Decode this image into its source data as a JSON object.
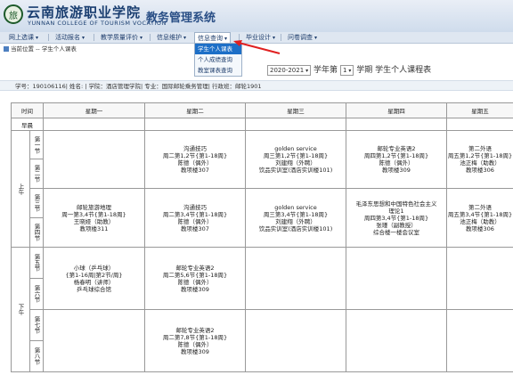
{
  "header": {
    "logo_glyph": "旅",
    "school_cn": "云南旅游职业学院",
    "school_en": "YUNNAN COLLEGE OF TOURISM VOCATION",
    "system_title": "教务管理系统"
  },
  "nav": {
    "items": [
      {
        "label": "网上选课"
      },
      {
        "label": "活动报名"
      },
      {
        "label": "教学质量评价"
      },
      {
        "label": "信息维护"
      },
      {
        "label": "信息查询"
      },
      {
        "label": "毕业设计"
      },
      {
        "label": "问卷调查"
      }
    ],
    "dropdown": [
      "学生个人课表",
      "个人成绩查询",
      "教室课表查询"
    ]
  },
  "breadcrumb": {
    "prefix": "当前位置",
    "sep": " -- ",
    "page": "学生个人课表"
  },
  "term": {
    "year": "2020-2021",
    "year_suffix": "学年第",
    "semester": "1",
    "title_suffix": "学期 学生个人课程表"
  },
  "student_info": "学号：190106116| 姓名: | 学院：酒店管理学院| 专业：国际邮轮乘务管理| 行政班：邮轮1901",
  "table": {
    "time_header": "时间",
    "days": [
      "星期一",
      "星期二",
      "星期三",
      "星期四",
      "星期五"
    ],
    "morning_early": "早晨",
    "am": "上午",
    "pm": "下午",
    "periods": [
      "第一节",
      "第二节",
      "第三节",
      "第四节",
      "第五节",
      "第六节",
      "第七节",
      "第八节"
    ],
    "courses": {
      "tue_1_2": [
        "沟通技巧",
        "周二第1,2节{第1-18周}",
        "陈德（偶外）",
        "教项楼307"
      ],
      "wed_1_2": [
        "golden service",
        "周三第1,2节{第1-18周}",
        "刘建翔（外聘）",
        "饮品实训室(酒店实训楼101)"
      ],
      "thu_1_2": [
        "邮轮专业英语2",
        "周四第1,2节{第1-18周}",
        "陈德（偶外）",
        "教项楼309"
      ],
      "fri_1_2": [
        "第二外语",
        "周五第1,2节{第1-18周}",
        "池正梅（助教）",
        "教项楼306"
      ],
      "mon_3_4": [
        "邮轮旅游地理",
        "周一第3,4节{第1-18周}",
        "王晓娅（助教）",
        "教项楼311"
      ],
      "tue_3_4": [
        "沟通技巧",
        "周二第3,4节{第1-18周}",
        "陈德（偶外）",
        "教项楼307"
      ],
      "wed_3_4": [
        "golden service",
        "周三第3,4节{第1-18周}",
        "刘建翔（外聘）",
        "饮品实训室(酒店实训楼101)"
      ],
      "thu_3_4": [
        "毛泽东思想和中国特色社会主义",
        "理论1",
        "周四第3,4节{第1-18周}",
        "张瑾（副教授）",
        "综合楼一楼会议室"
      ],
      "fri_3_4": [
        "第二外语",
        "周五第3,4节{第1-18周}",
        "池正梅（助教）",
        "教项楼306"
      ],
      "mon_5_6": [
        "小球（乒乓球）",
        "{第1-16周|第2节/周}",
        "杨春明（讲师）",
        "乒乓球综合馆"
      ],
      "tue_5_6": [
        "邮轮专业英语2",
        "周二第5,6节{第1-18周}",
        "陈德（偶外）",
        "教项楼309"
      ],
      "tue_7_8": [
        "邮轮专业英语2",
        "周二第7,8节{第1-18周}",
        "陈德（偶外）",
        "教项楼309"
      ]
    }
  }
}
